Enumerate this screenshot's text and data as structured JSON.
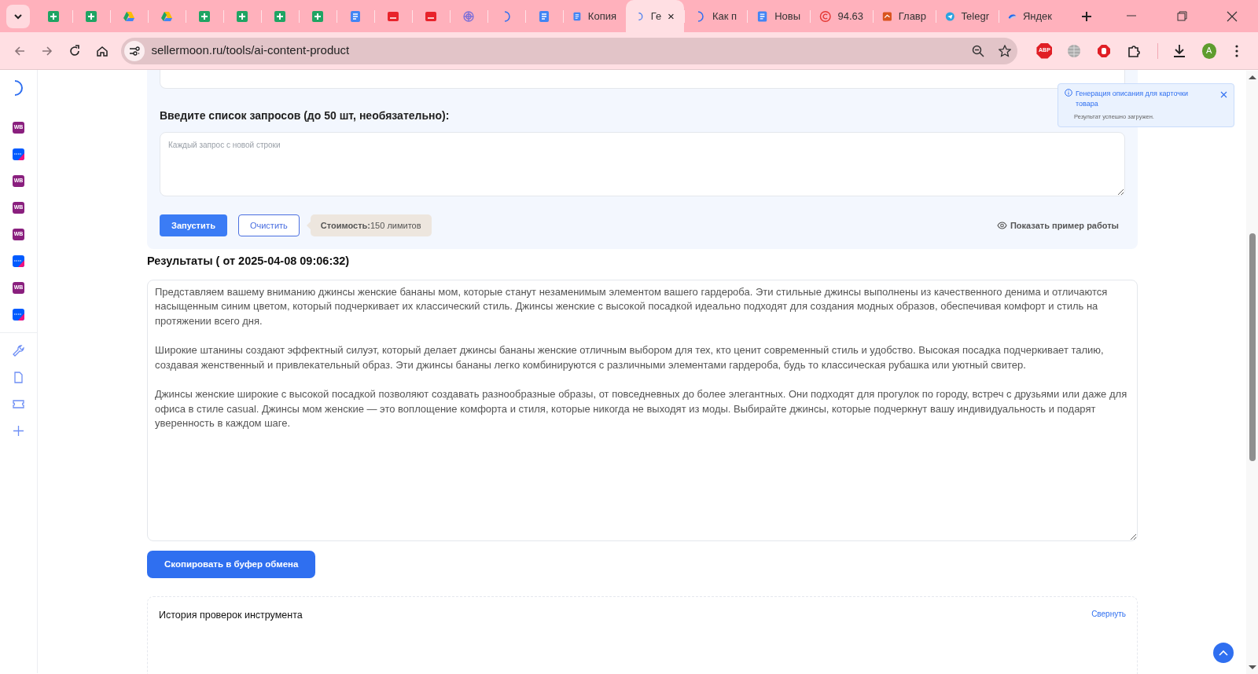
{
  "browser": {
    "tabs": [
      {
        "kind": "sheets",
        "selected": false
      },
      {
        "kind": "sheets",
        "selected": false
      },
      {
        "kind": "drive",
        "selected": false
      },
      {
        "kind": "drive",
        "selected": false
      },
      {
        "kind": "sheets",
        "selected": false
      },
      {
        "kind": "sheets",
        "selected": false
      },
      {
        "kind": "sheets",
        "selected": false
      },
      {
        "kind": "sheets",
        "selected": false
      },
      {
        "kind": "docs",
        "selected": false
      },
      {
        "kind": "red",
        "selected": false
      },
      {
        "kind": "red",
        "selected": false
      },
      {
        "kind": "swirl",
        "selected": false
      },
      {
        "kind": "moon",
        "selected": false
      },
      {
        "kind": "docs",
        "selected": false
      },
      {
        "kind": "docs",
        "title": "Копия",
        "selected": false
      },
      {
        "kind": "moon",
        "title": "Ге",
        "selected": true
      },
      {
        "kind": "moon",
        "title": "Как п",
        "selected": false
      },
      {
        "kind": "docs",
        "title": "Новы",
        "selected": false
      },
      {
        "kind": "copyright",
        "title": "94.63",
        "selected": false
      },
      {
        "kind": "orange",
        "title": "Главр",
        "selected": false
      },
      {
        "kind": "telegram",
        "title": "Telegr",
        "selected": false
      },
      {
        "kind": "cloud",
        "title": "Яндек",
        "selected": false
      }
    ],
    "url": "sellermoon.ru/tools/ai-content-product",
    "extensions": [
      {
        "kind": "abp",
        "label": "ABP"
      },
      {
        "kind": "globe"
      },
      {
        "kind": "stop"
      },
      {
        "kind": "puzzle"
      }
    ],
    "profile": "A"
  },
  "sidebar": {
    "items": [
      {
        "kind": "wb",
        "label": "WB"
      },
      {
        "kind": "ozon"
      },
      {
        "kind": "wb",
        "label": "WB"
      },
      {
        "kind": "wb",
        "label": "WB"
      },
      {
        "kind": "wb",
        "label": "WB"
      },
      {
        "kind": "ozon"
      },
      {
        "kind": "wb",
        "label": "WB"
      },
      {
        "kind": "ozon"
      }
    ],
    "tools": [
      {
        "kind": "wrench"
      },
      {
        "kind": "file"
      },
      {
        "kind": "ticket"
      },
      {
        "kind": "plus"
      }
    ]
  },
  "form": {
    "queries_label": "Введите список запросов (до 50 шт, необязательно):",
    "queries_placeholder": "Каждый запрос с новой строки",
    "run_button": "Запустить",
    "clear_button": "Очистить",
    "cost_label": "Стоимость:",
    "cost_value": "150 лимитов",
    "example_link": "Показать пример работы"
  },
  "results": {
    "heading": "Результаты ( от 2025-04-08 09:06:32)",
    "paragraphs": [
      "Представляем вашему вниманию джинсы женские бананы мом, которые станут незаменимым элементом вашего гардероба. Эти стильные джинсы выполнены из качественного денима и отличаются насыщенным синим цветом, который подчеркивает их классический стиль. Джинсы женские с высокой посадкой идеально подходят для создания модных образов, обеспечивая комфорт и стиль на протяжении всего дня.",
      "Широкие штанины создают эффектный силуэт, который делает джинсы бананы женские отличным выбором для тех, кто ценит современный стиль и удобство. Высокая посадка подчеркивает талию, создавая женственный и привлекательный образ. Эти джинсы бананы легко комбинируются с различными элементами гардероба, будь то классическая рубашка или уютный свитер.",
      "Джинсы женские широкие с высокой посадкой позволяют создавать разнообразные образы, от повседневных до более элегантных. Они подходят для прогулок по городу, встреч с друзьями или даже для офиса в стиле casual. Джинсы мом женские — это воплощение комфорта и стиля, которые никогда не выходят из моды. Выбирайте джинсы, которые подчеркнут вашу индивидуальность и подарят уверенность в каждом шаге."
    ],
    "copy_button": "Скопировать в буфер обмена"
  },
  "history": {
    "title": "История проверок инструмента",
    "collapse_link": "Свернуть"
  },
  "toast": {
    "title": "Генерация описания для карточки товара",
    "message": "Результат успешно загружен."
  }
}
